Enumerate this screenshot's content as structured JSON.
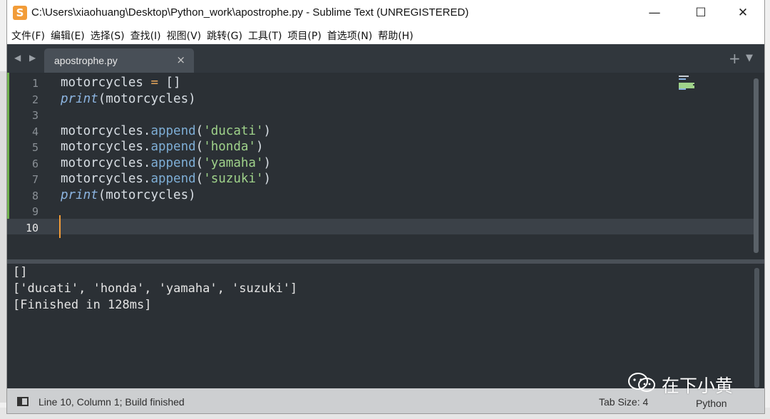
{
  "window": {
    "title": "C:\\Users\\xiaohuang\\Desktop\\Python_work\\apostrophe.py - Sublime Text (UNREGISTERED)",
    "app_icon_letter": "S",
    "minimize": "—",
    "maximize": "☐",
    "close": "✕"
  },
  "menu": [
    "文件(F)",
    "编辑(E)",
    "选择(S)",
    "查找(I)",
    "视图(V)",
    "跳转(G)",
    "工具(T)",
    "项目(P)",
    "首选项(N)",
    "帮助(H)"
  ],
  "tabs": {
    "nav_arrows": "◀ ▶",
    "active": "apostrophe.py",
    "close": "×",
    "plus": "+",
    "dropdown": "▼"
  },
  "code": {
    "current_line": 10,
    "lines": [
      {
        "num": "1",
        "parts": [
          [
            "motorcycles ",
            ""
          ],
          [
            "=",
            "op"
          ],
          [
            " []",
            ""
          ]
        ]
      },
      {
        "num": "2",
        "parts": [
          [
            "print",
            "kw"
          ],
          [
            "(motorcycles)",
            ""
          ]
        ]
      },
      {
        "num": "3",
        "parts": []
      },
      {
        "num": "4",
        "parts": [
          [
            "motorcycles.",
            ""
          ],
          [
            "append",
            "fn"
          ],
          [
            "(",
            ""
          ],
          [
            "'ducati'",
            "str"
          ],
          [
            ")",
            ""
          ]
        ]
      },
      {
        "num": "5",
        "parts": [
          [
            "motorcycles.",
            ""
          ],
          [
            "append",
            "fn"
          ],
          [
            "(",
            ""
          ],
          [
            "'honda'",
            "str"
          ],
          [
            ")",
            ""
          ]
        ]
      },
      {
        "num": "6",
        "parts": [
          [
            "motorcycles.",
            ""
          ],
          [
            "append",
            "fn"
          ],
          [
            "(",
            ""
          ],
          [
            "'yamaha'",
            "str"
          ],
          [
            ")",
            ""
          ]
        ]
      },
      {
        "num": "7",
        "parts": [
          [
            "motorcycles.",
            ""
          ],
          [
            "append",
            "fn"
          ],
          [
            "(",
            ""
          ],
          [
            "'suzuki'",
            "str"
          ],
          [
            ")",
            ""
          ]
        ]
      },
      {
        "num": "8",
        "parts": [
          [
            "print",
            "kw"
          ],
          [
            "(motorcycles)",
            ""
          ]
        ]
      },
      {
        "num": "9",
        "parts": []
      },
      {
        "num": "10",
        "parts": []
      }
    ]
  },
  "output": [
    "[]",
    "['ducati', 'honda', 'yamaha', 'suzuki']",
    "[Finished in 128ms]"
  ],
  "status": {
    "position": "Line 10, Column 1; Build finished",
    "tab_size": "Tab Size: 4",
    "syntax": "Python"
  },
  "watermark": {
    "text": "在下小黄",
    "icon": "wechat-icon"
  },
  "colors": {
    "editor_bg": "#2b3035",
    "accent": "#f29c38",
    "string": "#9fd28a",
    "keyword": "#8cb4e0"
  }
}
